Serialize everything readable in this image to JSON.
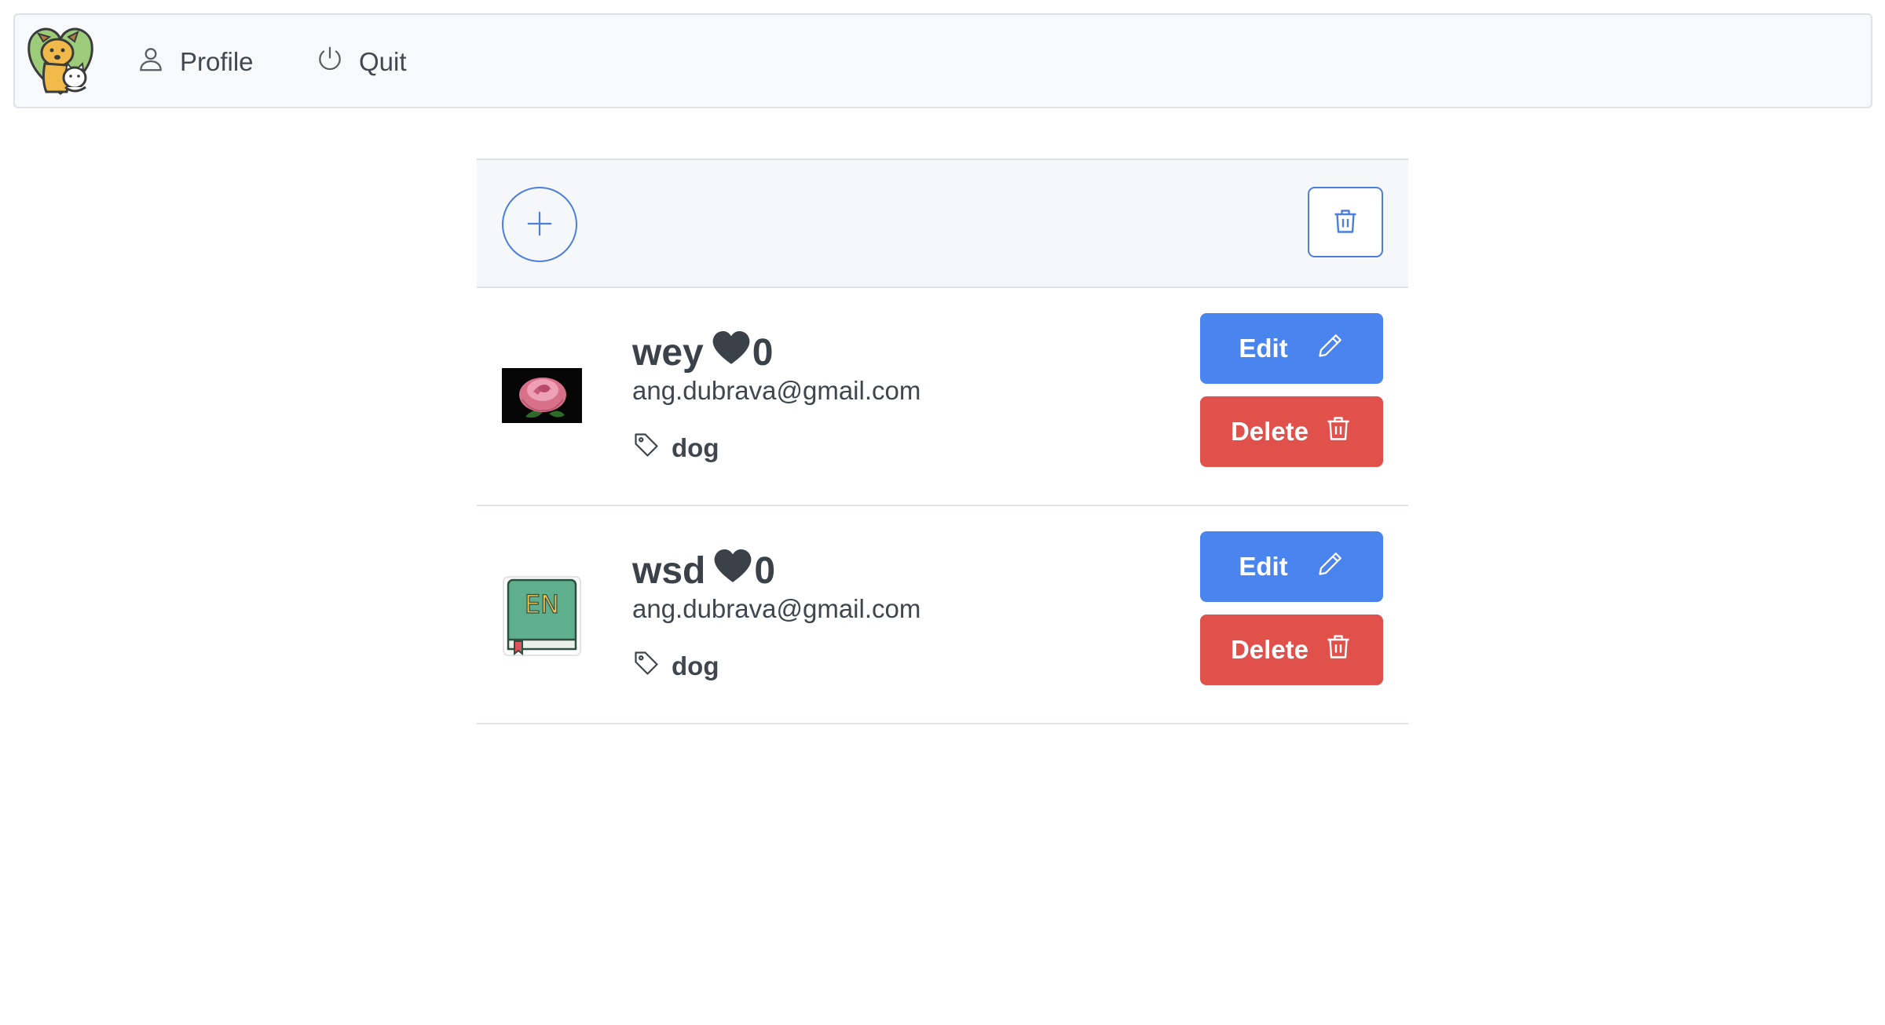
{
  "navbar": {
    "logo_icon": "dog-and-cat-logo-icon",
    "profile_label": "Profile",
    "profile_icon": "person-icon",
    "quit_label": "Quit",
    "quit_icon": "power-icon"
  },
  "toolbar": {
    "add_icon": "plus-icon",
    "delete_all_icon": "trash-icon",
    "accent": "#4a7fe0"
  },
  "pets": [
    {
      "name": "wey",
      "likes": "0",
      "email": "ang.dubrava@gmail.com",
      "tag": "dog",
      "image": "rose-photo",
      "edit_label": "Edit",
      "delete_label": "Delete"
    },
    {
      "name": "wsd",
      "likes": "0",
      "email": "ang.dubrava@gmail.com",
      "tag": "dog",
      "image": "en-book-icon",
      "edit_label": "Edit",
      "delete_label": "Delete"
    }
  ],
  "colors": {
    "edit": "#4a84ee",
    "delete": "#e0514c",
    "navbar_bg": "#f8f9fa"
  }
}
